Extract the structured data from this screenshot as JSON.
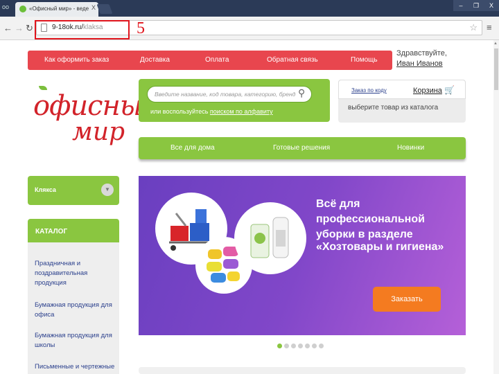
{
  "browser": {
    "tab_title": "«Офисный мир» - веде",
    "tab_close": "X",
    "url_host": "9-18ok.ru/",
    "url_path": "klaksa",
    "window_buttons": [
      "‒",
      "❐",
      "X"
    ]
  },
  "annotation": {
    "slide_number": "5",
    "highlight_color": "#e0141c"
  },
  "top_nav": {
    "items": [
      "Как оформить заказ",
      "Доставка",
      "Оплата",
      "Обратная связь",
      "Помощь"
    ]
  },
  "user": {
    "greeting": "Здравствуйте,",
    "name": "Иван Иванов"
  },
  "logo": {
    "line1": "офисный",
    "line2": "мир"
  },
  "search": {
    "placeholder": "Введите название, код товара, категорию, бренд",
    "hint_prefix": "или воспользуйтесь",
    "hint_link": "поиском по алфавиту"
  },
  "cart": {
    "code_order": "Заказ по коду",
    "title": "Корзина",
    "hint": "выберите товар из каталога"
  },
  "category_nav": {
    "items": [
      "Все для дома",
      "Готовые решения",
      "Новинки"
    ]
  },
  "city_select": {
    "value": "Кляксa"
  },
  "catalog": {
    "title": "КАТАЛОГ",
    "items": [
      "Праздничная и поздравительная продукция",
      "Бумажная продукция для офиса",
      "Бумажная продукция для школы",
      "Письменные и чертежные"
    ]
  },
  "banner": {
    "line1": "Всё для профессиональной",
    "line2": "уборки в разделе",
    "line3": "«Хозтовары и гигиена»",
    "button": "Заказать",
    "dots_total": 7,
    "dots_active": 0
  },
  "colors": {
    "green": "#8ac640",
    "red": "#e8464e",
    "purple": "#7a45c8",
    "orange": "#f47b20"
  }
}
